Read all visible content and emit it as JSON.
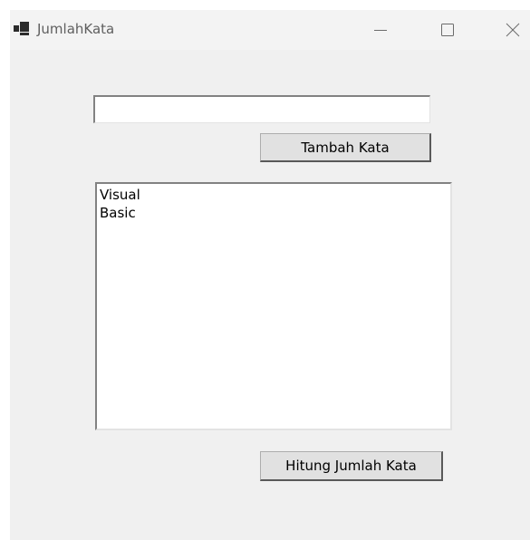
{
  "window": {
    "title": "JumlahKata",
    "icon": "winforms-app-icon",
    "controls": {
      "minimize_icon": "minimize-icon",
      "maximize_icon": "maximize-icon",
      "close_icon": "close-icon"
    }
  },
  "form": {
    "word_input": {
      "value": "",
      "placeholder": ""
    },
    "add_button_label": "Tambah Kata",
    "word_list": {
      "items": [
        "Visual",
        "Basic"
      ]
    },
    "count_button_label": "Hitung Jumlah Kata"
  },
  "colors": {
    "window_background": "#f0f0f0",
    "titlebar_background": "#f3f3f3",
    "button_face": "#e1e1e1",
    "field_background": "#ffffff"
  }
}
